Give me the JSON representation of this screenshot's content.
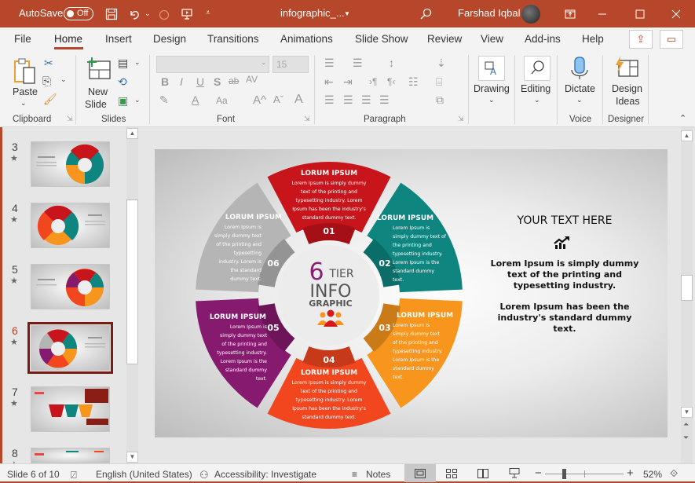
{
  "titlebar": {
    "autosave_label": "AutoSave",
    "autosave_state": "Off",
    "filename": "infographic_...",
    "user": "Farshad Iqbal",
    "icons": [
      "save-icon",
      "undo-icon",
      "redo-icon",
      "present-icon",
      "customize-icon",
      "search-icon",
      "ribbon-display-icon",
      "minimize-icon",
      "maximize-icon",
      "close-icon"
    ]
  },
  "menu": {
    "tabs": [
      "File",
      "Home",
      "Insert",
      "Design",
      "Transitions",
      "Animations",
      "Slide Show",
      "Review",
      "View",
      "Add-ins",
      "Help"
    ],
    "active": "Home"
  },
  "ribbon": {
    "clipboard": {
      "paste": "Paste",
      "label": "Clipboard"
    },
    "slides": {
      "new_slide_line1": "New",
      "new_slide_line2": "Slide",
      "label": "Slides"
    },
    "font": {
      "name_value": "",
      "size_value": "15",
      "label": "Font",
      "buttons": [
        "B",
        "I",
        "U",
        "S",
        "ab",
        "AV",
        "Aa",
        "A^",
        "Aˇ"
      ]
    },
    "paragraph": {
      "label": "Paragraph"
    },
    "drawing": {
      "label": "Drawing"
    },
    "editing": {
      "label": "Editing"
    },
    "voice": {
      "dictate": "Dictate",
      "label": "Voice"
    },
    "designer": {
      "line1": "Design",
      "line2": "Ideas",
      "label": "Designer"
    }
  },
  "slides_panel": {
    "items": [
      {
        "num": "3",
        "starred": true
      },
      {
        "num": "4",
        "starred": true
      },
      {
        "num": "5",
        "starred": true
      },
      {
        "num": "6",
        "starred": true,
        "selected": true
      },
      {
        "num": "7",
        "starred": true
      },
      {
        "num": "8",
        "starred": true
      }
    ]
  },
  "slide": {
    "center": {
      "six": "6",
      "tier": "TIER",
      "info": "INFO",
      "graphic": "GRAPHIC"
    },
    "segments": [
      {
        "num": "01",
        "title": "LORUM IPSUM",
        "color": "#c8141b",
        "body": [
          "Lorem Ipsum is simply dummy",
          "text of the printing and",
          "typesetting industry. Lorem",
          "Ipsum has been the industry's",
          "standard dummy text."
        ]
      },
      {
        "num": "02",
        "title": "LORUM IPSUM",
        "color": "#0e857f",
        "body": [
          "Lorem Ipsum is",
          "simply dummy text of",
          "the printing and",
          "typesetting industry.",
          "Lorem Ipsum is the",
          "standard dummy",
          "text."
        ]
      },
      {
        "num": "03",
        "title": "LORUM IPSUM",
        "color": "#f7951d",
        "body": [
          "Lorem Ipsum is",
          "simply dummy text",
          "of the printing and",
          "typesetting industry.",
          "Lorem Ipsum is the",
          "standard dummy",
          "text."
        ]
      },
      {
        "num": "04",
        "title": "LORUM IPSUM",
        "color": "#f2461f",
        "body": [
          "Lorem Ipsum is simply dummy",
          "text of the printing and",
          "typesetting industry. Lorem",
          "Ipsum has been the industry's",
          "standard dummy text."
        ]
      },
      {
        "num": "05",
        "title": "LORUM IPSUM",
        "color": "#861a6e",
        "body": [
          "Lorem Ipsum is",
          "simply dummy text",
          "of the printing and",
          "typesetting industry.",
          "Lorem Ipsum is the",
          "standard dummy",
          "text."
        ]
      },
      {
        "num": "06",
        "title": "LORUM IPSUM",
        "color": "#b5b5b5",
        "body": [
          "Lorem Ipsum is",
          "simply dummy text",
          "of the printing and",
          "typesetting",
          "industry. Lorem is",
          "the standard",
          "dummy text."
        ]
      }
    ],
    "right": {
      "heading": "YOUR TEXT HERE",
      "para1": "Lorem Ipsum is simply dummy text of the printing and typesetting industry.",
      "para2": "Lorem Ipsum has been the industry's standard dummy text."
    }
  },
  "status": {
    "slide_info": "Slide 6 of 10",
    "language": "English (United States)",
    "accessibility": "Accessibility: Investigate",
    "notes": "Notes",
    "zoom": "52%",
    "zoom_minus": "−",
    "zoom_plus": "+"
  }
}
